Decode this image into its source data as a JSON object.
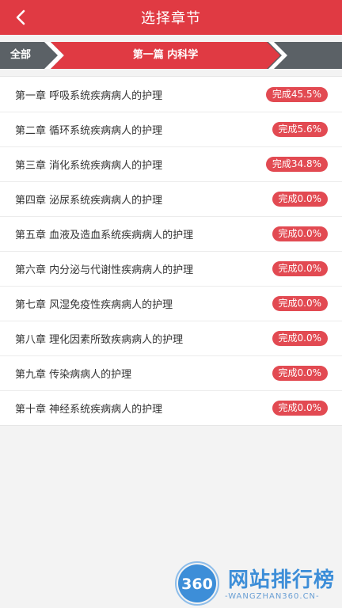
{
  "header": {
    "title": "选择章节",
    "color": "#e03a43"
  },
  "breadcrumb": {
    "all_label": "全部",
    "current_label": "第一篇 内科学"
  },
  "chapters": [
    {
      "label": "第一章 呼吸系统疾病病人的护理",
      "status": "完成45.5%",
      "progress": 45.5
    },
    {
      "label": "第二章 循环系统疾病病人的护理",
      "status": "完成5.6%",
      "progress": 5.6
    },
    {
      "label": "第三章 消化系统疾病病人的护理",
      "status": "完成34.8%",
      "progress": 34.8
    },
    {
      "label": "第四章 泌尿系统疾病病人的护理",
      "status": "完成0.0%",
      "progress": 0.0
    },
    {
      "label": "第五章 血液及造血系统疾病病人的护理",
      "status": "完成0.0%",
      "progress": 0.0
    },
    {
      "label": "第六章 内分泌与代谢性疾病病人的护理",
      "status": "完成0.0%",
      "progress": 0.0
    },
    {
      "label": "第七章 风湿免疫性疾病病人的护理",
      "status": "完成0.0%",
      "progress": 0.0
    },
    {
      "label": "第八章 理化因素所致疾病病人的护理",
      "status": "完成0.0%",
      "progress": 0.0
    },
    {
      "label": "第九章 传染病病人的护理",
      "status": "完成0.0%",
      "progress": 0.0
    },
    {
      "label": "第十章 神经系统疾病病人的护理",
      "status": "完成0.0%",
      "progress": 0.0
    }
  ],
  "watermark": {
    "logo_text": "360",
    "title": "网站排行榜",
    "subtitle": "-WANGZHAN360.CN-"
  },
  "colors": {
    "accent": "#e03a43",
    "badge": "#e24a52",
    "crumb_gray": "#5b6166"
  }
}
